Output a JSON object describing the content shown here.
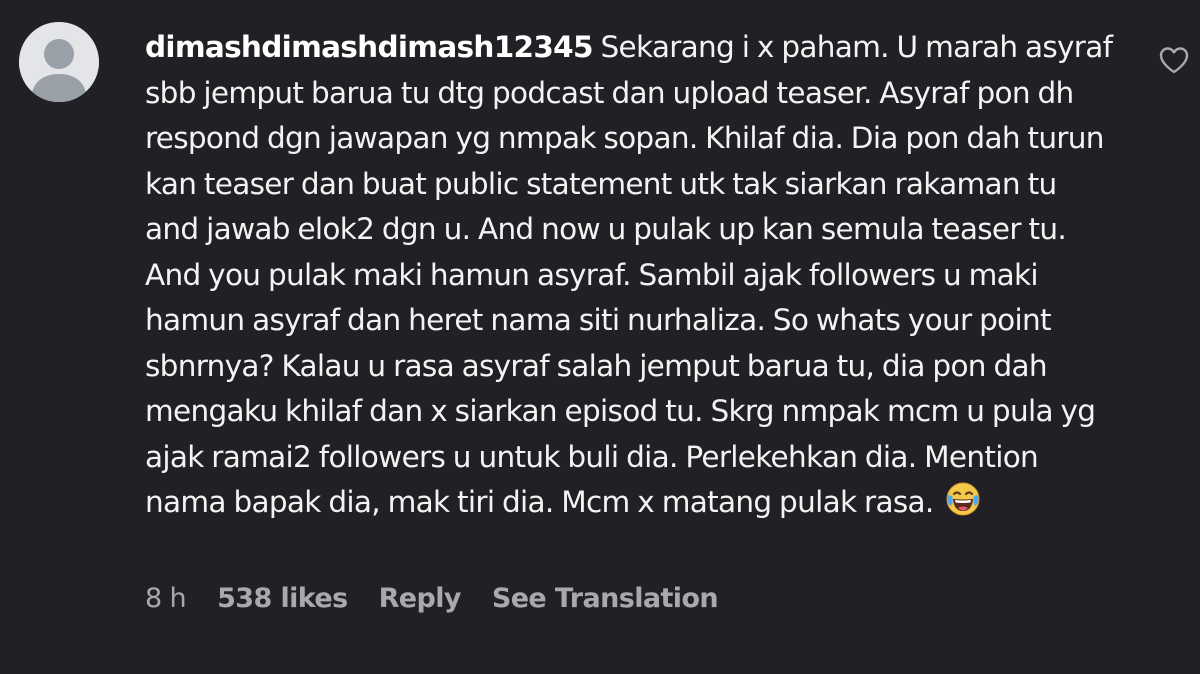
{
  "comment": {
    "username": "dimashdimashdimash12345",
    "text": "Sekarang i x paham. U marah asyraf sbb jemput barua tu dtg podcast dan upload teaser. Asyraf pon dh respond dgn jawapan yg nmpak sopan. Khilaf dia. Dia pon dah turun kan teaser dan buat public statement utk tak siarkan rakaman tu and jawab elok2 dgn u. And now u pulak up kan semula teaser tu. And you pulak maki hamun asyraf. Sambil ajak followers u maki hamun asyraf dan heret nama siti nurhaliza. So whats your point sbnrnya? Kalau u rasa asyraf salah jemput barua tu, dia pon dah mengaku khilaf dan x siarkan episod tu. Skrg nmpak mcm u pula yg ajak ramai2 followers u untuk buli dia. Perlekehkan dia. Mention nama bapak dia, mak tiri dia. Mcm x matang pulak rasa.",
    "emoji": "laughing-tears-emoji"
  },
  "meta": {
    "time": "8 h",
    "likes": "538 likes",
    "reply": "Reply",
    "translation": "See Translation"
  },
  "icons": {
    "avatar": "default-avatar-icon",
    "like": "heart-outline-icon"
  },
  "colors": {
    "background": "#212125",
    "text": "#f3f3f3",
    "meta": "#a8a8ad",
    "avatar_bg": "#e3e5e8",
    "avatar_fg": "#9aa0a8"
  }
}
